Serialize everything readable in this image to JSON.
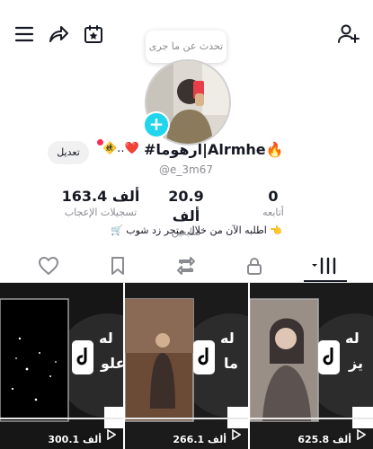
{
  "header": {
    "menu_icon": "hamburger-icon",
    "share_icon": "share-arrow-icon",
    "calendar_icon": "calendar-star-icon",
    "add_friend_icon": "add-user-icon"
  },
  "bubble": {
    "text": "تحدث عن ما جرى"
  },
  "profile": {
    "edit_label": "تعديل",
    "display_name": "#ارهوما|Alrmhe🔥",
    "name_suffix": "🚸..❤️",
    "handle": "@e_3m67"
  },
  "stats": [
    {
      "value": "163.4 ألف",
      "label": "تسجيلات الإعجاب"
    },
    {
      "value": "20.9 ألف",
      "label": "متابعين"
    },
    {
      "value": "0",
      "label": "أتابعه"
    }
  ],
  "bio": {
    "text": "🛒 اطلبه الآن من خلال متجر زد شوب 👈"
  },
  "tabs": [
    "liked-heart-icon",
    "favorites-bookmark-icon",
    "reposts-icon",
    "private-lock-icon",
    "videos-grid-icon"
  ],
  "videos": [
    {
      "views": "300.1 ألف",
      "overlay": [
        "له",
        "علو"
      ]
    },
    {
      "views": "266.1 ألف",
      "overlay": [
        "له",
        "ما"
      ]
    },
    {
      "views": "625.8 ألف",
      "overlay": [
        "له",
        "يز"
      ]
    }
  ],
  "colors": {
    "accent": "#20d5ec",
    "live_dot": "#fe2c55",
    "text": "#161823",
    "muted": "#8a8b91"
  }
}
